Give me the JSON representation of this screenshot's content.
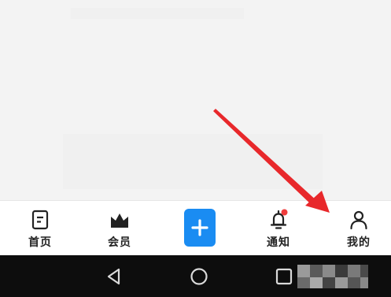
{
  "tabs": [
    {
      "label": "首页",
      "icon": "document-icon"
    },
    {
      "label": "会员",
      "icon": "crown-icon"
    },
    {
      "label": "",
      "icon": "plus-icon"
    },
    {
      "label": "通知",
      "icon": "bell-icon"
    },
    {
      "label": "我的",
      "icon": "person-icon"
    }
  ],
  "colors": {
    "accent": "#1a8cf2",
    "notification_dot": "#f03c3c",
    "arrow": "#e8282b"
  },
  "system_nav": [
    "back-icon",
    "home-icon",
    "recents-icon"
  ]
}
